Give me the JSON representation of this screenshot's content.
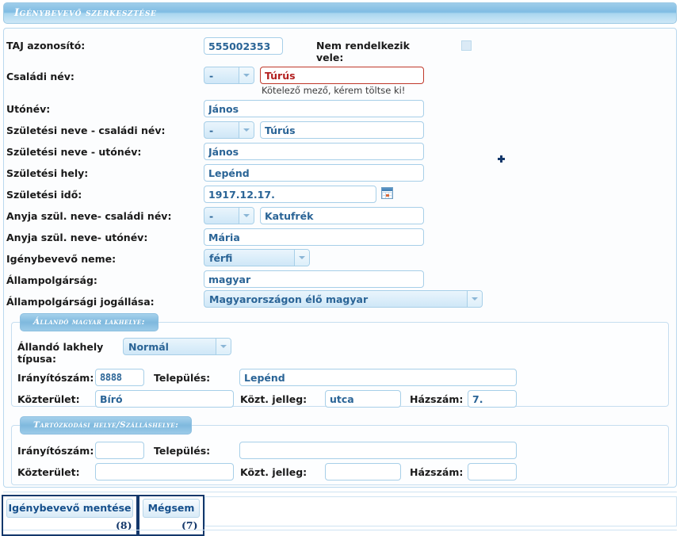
{
  "header": {
    "title": "Igénybevevő szerkesztése"
  },
  "form": {
    "fields": [
      {
        "label": "TAJ azonosító:",
        "value": "555002353"
      },
      {
        "label": "Nem rendelkezik vele:",
        "value": ""
      },
      {
        "label": "Családi név:",
        "prefix": "-",
        "value": "Túrús",
        "error": "Kötelező mező, kérem töltse ki!"
      },
      {
        "label": "Utónév:",
        "value": "János"
      },
      {
        "label": "Születési neve - családi név:",
        "prefix": "-",
        "value": "Túrús"
      },
      {
        "label": "Születési neve - utónév:",
        "value": "János"
      },
      {
        "label": "Születési hely:",
        "value": "Lepénd"
      },
      {
        "label": "Születési idő:",
        "value": "1917.12.17."
      },
      {
        "label": "Anyja szül. neve- családi név:",
        "prefix": "-",
        "value": "Katufrék"
      },
      {
        "label": "Anyja szül. neve- utónév:",
        "value": "Mária"
      },
      {
        "label": "Igénybevevő neme:",
        "value": "férfi"
      },
      {
        "label": "Állampolgárság:",
        "value": "magyar"
      },
      {
        "label": "Állampolgársági jogállása:",
        "value": "Magyarországon élő magyar"
      }
    ]
  },
  "permanent_address": {
    "legend": "Állandó magyar lakhelye:",
    "type_label": "Állandó lakhely típusa:",
    "type_value": "Normál",
    "zip_label": "Irányítószám:",
    "zip_value": "8888",
    "city_label": "Település:",
    "city_value": "Lepénd",
    "street_label": "Közterület:",
    "street_value": "Bíró",
    "street_type_label": "Közt. jelleg:",
    "street_type_value": "utca",
    "house_label": "Házszám:",
    "house_value": "7."
  },
  "temporary_address": {
    "legend": "Tartózkodási helye/Szálláshelye:",
    "zip_label": "Irányítószám:",
    "zip_value": "",
    "city_label": "Település:",
    "city_value": "",
    "street_label": "Közterület:",
    "street_value": "",
    "street_type_label": "Közt. jelleg:",
    "street_type_value": "",
    "house_label": "Házszám:",
    "house_value": ""
  },
  "actions": {
    "save_label": "Igénybevevő mentése",
    "save_number": "(8)",
    "cancel_label": "Mégsem",
    "cancel_number": "(7)"
  },
  "colors": {
    "header_blue": "#7fbce3",
    "field_border": "#a7cfe8",
    "field_text": "#2a6496",
    "error_red": "#c0392b",
    "anno_navy": "#14386b"
  }
}
